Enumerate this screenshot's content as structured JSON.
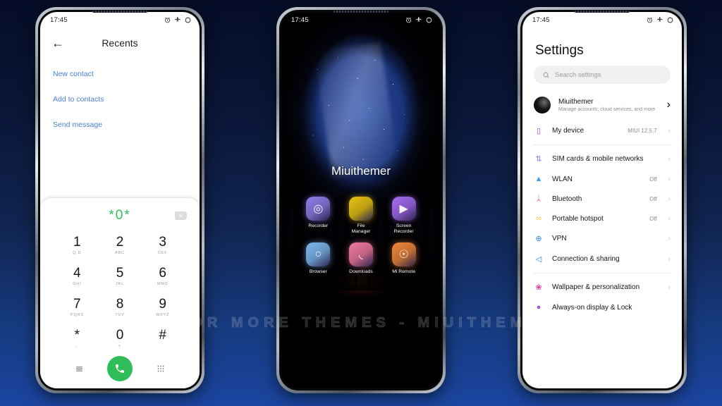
{
  "background": {
    "top_color": "#050d27",
    "bottom_color": "#1b45a0"
  },
  "watermark": {
    "text": "VISIT  FOR  MORE  THEMES  -  MIUITHEMER.COM"
  },
  "phone_dialer": {
    "status_bar": {
      "time": "17:45",
      "icons": [
        "alarm-icon",
        "airplane-mode-icon",
        "battery-icon"
      ]
    },
    "header": {
      "back_icon": "back-arrow-icon",
      "title": "Recents"
    },
    "links": [
      "New contact",
      "Add to contacts",
      "Send message"
    ],
    "dialpad": {
      "number": "*0*",
      "delete_icon": "backspace-icon",
      "keys": [
        {
          "digit": "1",
          "letters": "Q.D"
        },
        {
          "digit": "2",
          "letters": "ABC"
        },
        {
          "digit": "3",
          "letters": "DEF"
        },
        {
          "digit": "4",
          "letters": "GHI"
        },
        {
          "digit": "5",
          "letters": "JKL"
        },
        {
          "digit": "6",
          "letters": "MNO"
        },
        {
          "digit": "7",
          "letters": "PQRS"
        },
        {
          "digit": "8",
          "letters": "TUV"
        },
        {
          "digit": "9",
          "letters": "WXYZ"
        },
        {
          "digit": "*",
          "letters": ","
        },
        {
          "digit": "0",
          "letters": "+"
        },
        {
          "digit": "#",
          "letters": ""
        }
      ],
      "actions": {
        "menu_icon": "hamburger-menu-icon",
        "call_icon": "phone-call-icon",
        "call_color": "#2fbd5a",
        "keypad_icon": "dialpad-icon"
      }
    }
  },
  "phone_home": {
    "status_bar": {
      "time": "17:45",
      "icons": [
        "alarm-icon",
        "airplane-mode-icon",
        "battery-icon"
      ]
    },
    "wallpaper_name": "starry-night-cave-wallpaper",
    "widget_text": "Miuithemer",
    "apps": [
      {
        "label": "Recorder",
        "icon": "recorder-icon",
        "glyph": "◎",
        "color": "#8f7ee8"
      },
      {
        "label": "File\nManager",
        "icon": "file-manager-icon",
        "glyph": "",
        "color": "#e8c313"
      },
      {
        "label": "Screen\nRecorder",
        "icon": "screen-recorder-icon",
        "glyph": "▶",
        "color": "#a46cf0"
      },
      {
        "label": "Browser",
        "icon": "browser-icon",
        "glyph": "○",
        "color": "#7fb7f0"
      },
      {
        "label": "Downloads",
        "icon": "downloads-icon",
        "glyph": "◟",
        "color": "#f07aa0"
      },
      {
        "label": "Mi Remote",
        "icon": "mi-remote-icon",
        "glyph": "☉",
        "color": "#f0883c"
      }
    ]
  },
  "phone_settings": {
    "status_bar": {
      "time": "17:45",
      "icons": [
        "alarm-icon",
        "airplane-mode-icon",
        "battery-icon"
      ]
    },
    "title": "Settings",
    "search": {
      "placeholder": "Search settings",
      "icon": "search-icon"
    },
    "account": {
      "name": "Miuithemer",
      "subtitle": "Manage accounts, cloud services, and more",
      "avatar": "user-avatar",
      "chevron": "›"
    },
    "device": {
      "icon": "my-device-icon",
      "glyph": "▯",
      "color": "#b03ce0",
      "label": "My device",
      "value": "MIUI 12.5.7",
      "chevron": "›"
    },
    "items": [
      {
        "icon": "sim-cards-icon",
        "glyph": "⇅",
        "color": "#8e7ce8",
        "label": "SIM cards & mobile networks",
        "value": "",
        "chevron": "›"
      },
      {
        "icon": "wlan-icon",
        "glyph": "▲",
        "color": "#3fa0ef",
        "label": "WLAN",
        "value": "Off",
        "chevron": "›"
      },
      {
        "icon": "bluetooth-icon",
        "glyph": "ᛦ",
        "color": "#e0334f",
        "label": "Bluetooth",
        "value": "Off",
        "chevron": "›"
      },
      {
        "icon": "portable-hotspot-icon",
        "glyph": "∞",
        "color": "#efc32b",
        "label": "Portable hotspot",
        "value": "Off",
        "chevron": "›"
      },
      {
        "icon": "vpn-icon",
        "glyph": "⊕",
        "color": "#2a86e0",
        "label": "VPN",
        "value": "",
        "chevron": "›"
      },
      {
        "icon": "connection-sharing-icon",
        "glyph": "◁",
        "color": "#2f74e0",
        "label": "Connection & sharing",
        "value": "",
        "chevron": "›"
      }
    ],
    "items2": [
      {
        "icon": "wallpaper-personalization-icon",
        "glyph": "❀",
        "color": "#e0338f",
        "label": "Wallpaper & personalization",
        "value": "",
        "chevron": "›"
      },
      {
        "icon": "always-on-display-icon",
        "glyph": "●",
        "color": "#9a5cd8",
        "label": "Always-on display & Lock",
        "value": "",
        "chevron": ""
      }
    ]
  }
}
